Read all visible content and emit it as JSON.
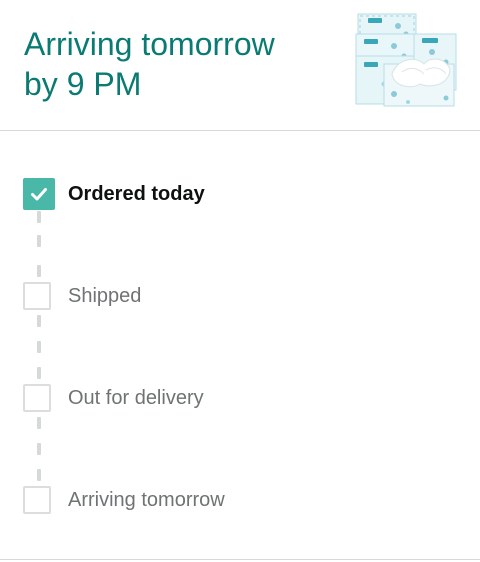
{
  "delivery": {
    "headline_line1": "Arriving tomorrow",
    "headline_line2": "by 9 PM"
  },
  "product": {
    "image_alt": "tissue-box-pack-image"
  },
  "tracker": {
    "steps": [
      {
        "label": "Ordered today",
        "status": "completed"
      },
      {
        "label": "Shipped",
        "status": "pending"
      },
      {
        "label": "Out for delivery",
        "status": "pending"
      },
      {
        "label": "Arriving tomorrow",
        "status": "pending"
      }
    ]
  },
  "colors": {
    "headline": "#0a7b73",
    "check_fill": "#4ab8a8",
    "pending_border": "#dddddd",
    "divider": "#d5d9d9"
  }
}
